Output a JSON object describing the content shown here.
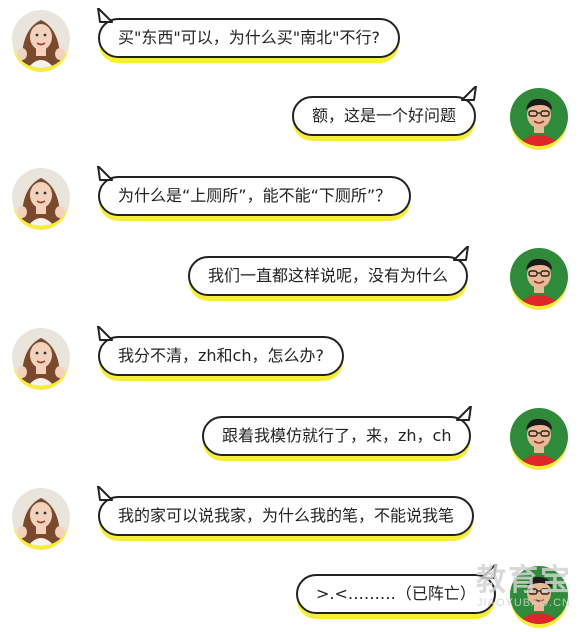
{
  "messages": [
    {
      "side": "left",
      "text": "买\"东西\"可以，为什么买\"南北\"不行?"
    },
    {
      "side": "right",
      "text": "额，这是一个好问题"
    },
    {
      "side": "left",
      "text": "为什么是“上厕所”，能不能“下厕所”？"
    },
    {
      "side": "right",
      "text": "我们一直都这样说呢，没有为什么"
    },
    {
      "side": "left",
      "text": "我分不清，zh和ch，怎么办?"
    },
    {
      "side": "right",
      "text": "跟着我模仿就行了，来，zh，ch"
    },
    {
      "side": "left",
      "text": "我的家可以说我家，为什么我的笔，不能说我笔"
    },
    {
      "side": "right",
      "text": ">.<………（已阵亡）"
    }
  ],
  "watermark": {
    "cn": "教育宝",
    "en": "JIAOYUBAO.CN"
  },
  "colors": {
    "bubble_shadow": "#f6ee3a",
    "bubble_border": "#222222",
    "girl_hair": "#7a4a2c",
    "boy_shirt": "#e0262b"
  },
  "avatars": {
    "left": "girl-avatar",
    "right": "boy-avatar"
  }
}
